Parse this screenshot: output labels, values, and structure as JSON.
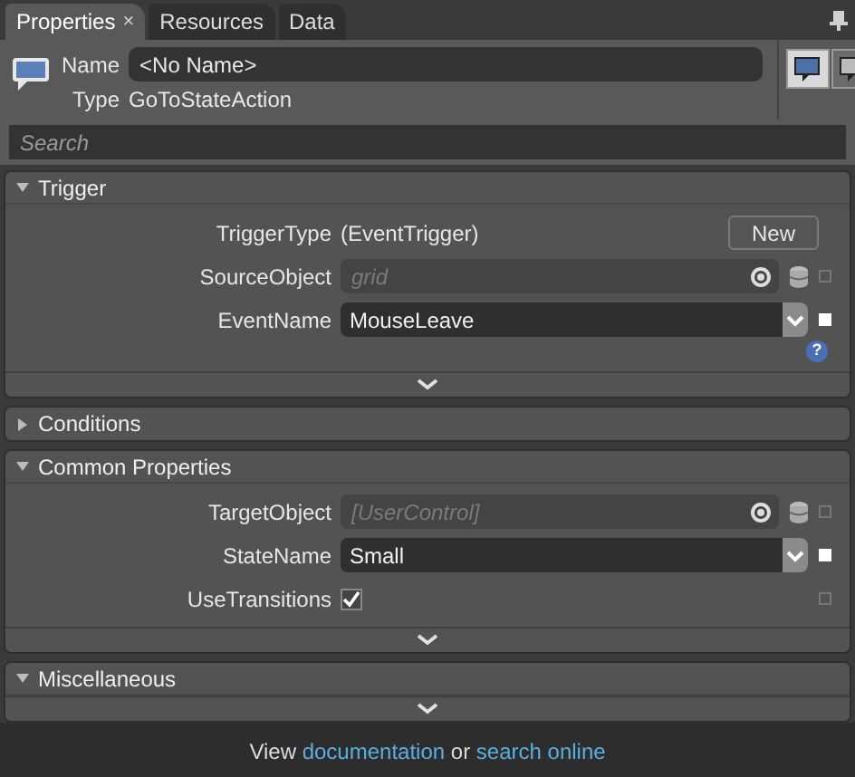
{
  "tabs": [
    {
      "label": "Properties",
      "close": "×",
      "selected": true
    },
    {
      "label": "Resources",
      "selected": false
    },
    {
      "label": "Data",
      "selected": false
    }
  ],
  "header": {
    "name_label": "Name",
    "name_value": "<No Name>",
    "type_label": "Type",
    "type_value": "GoToStateAction"
  },
  "view_buttons": [
    {
      "selected": true
    },
    {
      "selected": false
    }
  ],
  "search": {
    "placeholder": "Search"
  },
  "sections": [
    {
      "title": "Trigger",
      "expanded": true,
      "help": "?",
      "rows": [
        {
          "kind": "text",
          "label": "TriggerType",
          "value": "(EventTrigger)",
          "button": "New"
        },
        {
          "kind": "picker",
          "label": "SourceObject",
          "placeholder": "grid",
          "marker_set": false
        },
        {
          "kind": "dropdown",
          "label": "EventName",
          "value": "MouseLeave",
          "marker_set": true
        }
      ]
    },
    {
      "title": "Conditions",
      "expanded": false
    },
    {
      "title": "Common Properties",
      "expanded": true,
      "rows": [
        {
          "kind": "picker",
          "label": "TargetObject",
          "placeholder": "[UserControl]",
          "marker_set": false
        },
        {
          "kind": "dropdown",
          "label": "StateName",
          "value": "Small",
          "marker_set": true
        },
        {
          "kind": "checkbox",
          "label": "UseTransitions",
          "checked": true,
          "marker_set": false
        }
      ]
    },
    {
      "title": "Miscellaneous",
      "expanded": true
    }
  ],
  "footer": [
    {
      "kind": "text",
      "text": "View"
    },
    {
      "kind": "link",
      "text": "documentation"
    },
    {
      "kind": "text",
      "text": "or"
    },
    {
      "kind": "link",
      "text": "search online"
    }
  ]
}
